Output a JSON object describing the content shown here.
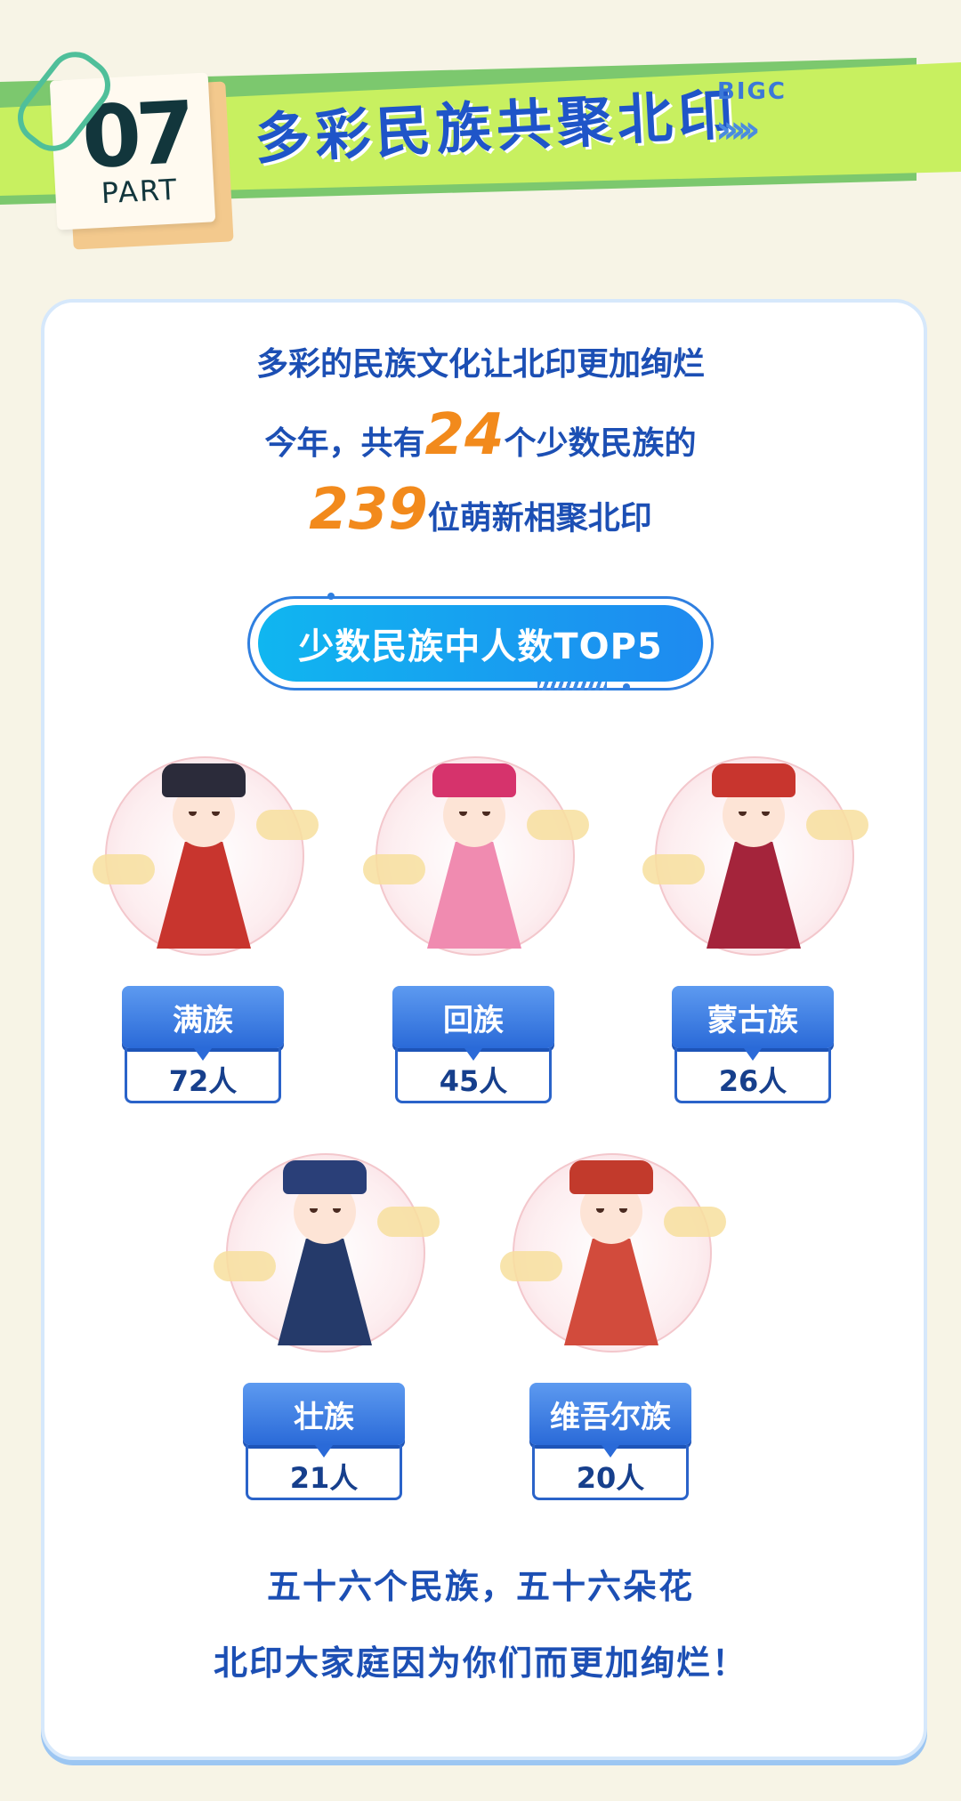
{
  "header": {
    "part_number": "07",
    "part_label": "PART",
    "title": "多彩民族共聚北印",
    "brand": "BIGC",
    "arrows": "›››››"
  },
  "intro": {
    "line1": "多彩的民族文化让北印更加绚烂",
    "line2_prefix": "今年，共有",
    "ethnic_group_count": "24",
    "line2_suffix": "个少数民族的",
    "student_count": "239",
    "line3_suffix": "位萌新相聚北印"
  },
  "top5": {
    "title": "少数民族中人数TOP5",
    "items": [
      {
        "name": "满族",
        "count": "72人",
        "hat_color": "#2b2b3a",
        "dress_color": "#c8352e"
      },
      {
        "name": "回族",
        "count": "45人",
        "hat_color": "#d6336c",
        "dress_color": "#f08bb0"
      },
      {
        "name": "蒙古族",
        "count": "26人",
        "hat_color": "#c8352e",
        "dress_color": "#a4243b"
      },
      {
        "name": "壮族",
        "count": "21人",
        "hat_color": "#2a3f78",
        "dress_color": "#253a6a"
      },
      {
        "name": "维吾尔族",
        "count": "20人",
        "hat_color": "#c23a2c",
        "dress_color": "#d24b3c"
      }
    ]
  },
  "outro": {
    "line1": "五十六个民族，五十六朵花",
    "line2": "北印大家庭因为你们而更加绚烂！"
  },
  "colors": {
    "accent_blue": "#1c4fb4",
    "highlight_orange": "#f28a1c",
    "banner_green": "#c8f060"
  }
}
